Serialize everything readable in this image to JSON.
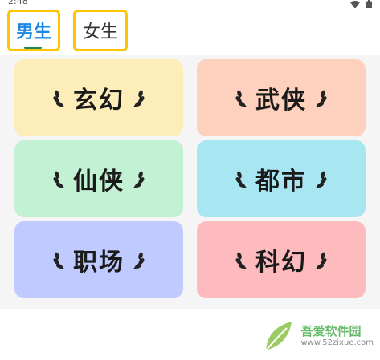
{
  "status_bar": {
    "time": "2:48"
  },
  "tabs": [
    {
      "label": "男生",
      "selected": true
    },
    {
      "label": "女生",
      "selected": false
    }
  ],
  "categories": [
    {
      "label": "玄幻",
      "color": "#FDEDB8"
    },
    {
      "label": "武侠",
      "color": "#FDD1BD"
    },
    {
      "label": "仙侠",
      "color": "#C2F1D4"
    },
    {
      "label": "都市",
      "color": "#A8E6F2"
    },
    {
      "label": "职场",
      "color": "#BFCBFF"
    },
    {
      "label": "科幻",
      "color": "#FDBBBD"
    }
  ],
  "watermark": {
    "title": "吾爱软件园",
    "url": "www.52zixue.com"
  },
  "colors": {
    "tab_highlight_border": "#FFC400",
    "tab_selected_text": "#1E88E5",
    "indicator": "#1B8A4C"
  }
}
